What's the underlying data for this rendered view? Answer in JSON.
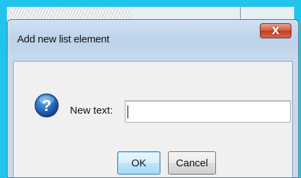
{
  "dialog": {
    "title": "Add new list element",
    "close_label": "X",
    "prompt_label": "New text:",
    "input_value": "",
    "ok_label": "OK",
    "cancel_label": "Cancel",
    "icon": "question-icon"
  },
  "colors": {
    "screen_background": "#21c4ec",
    "titlebar": "#bdd3ea",
    "close_button": "#c23a22",
    "icon_blue": "#1f5fae",
    "content_background": "#f0f0f0"
  }
}
